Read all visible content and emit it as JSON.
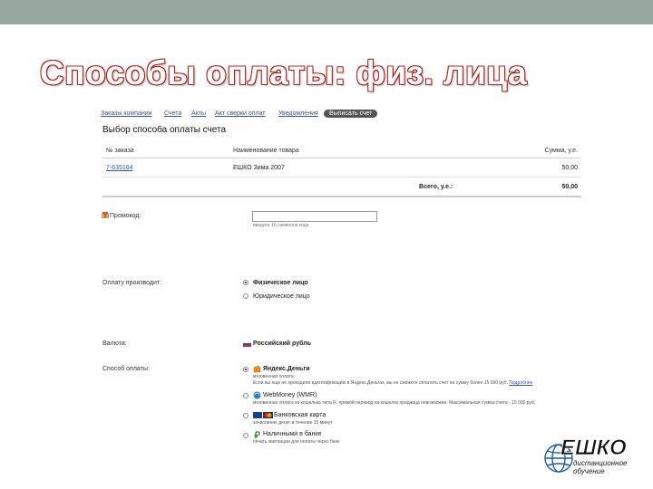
{
  "slide": {
    "title": "Способы оплаты: физ. лица"
  },
  "nav": {
    "links": [
      "Заказы компании",
      "Счета",
      "Акты",
      "Акт сверки оплат",
      "Уведомления"
    ],
    "active": "Выписать счет"
  },
  "page": {
    "heading": "Выбор способа оплаты счета"
  },
  "orders": {
    "headers": [
      "№ заказа",
      "Наименование товара",
      "Сумма, у.е."
    ],
    "rows": [
      {
        "order": "7-635164",
        "product": "ЕШКО Зима 2007",
        "amount": "50,00"
      }
    ],
    "total_label": "Всего, у.е.:",
    "total_value": "50,00"
  },
  "promo": {
    "label": "Промокод:",
    "value": "",
    "hint": "введите 16 символов кода"
  },
  "payer": {
    "label": "Оплату производит:",
    "options": [
      {
        "label": "Физическое лицо",
        "selected": true
      },
      {
        "label": "Юридическое лицо",
        "selected": false
      }
    ]
  },
  "currency": {
    "label": "Валюта:",
    "value": "Российский рубль"
  },
  "method": {
    "label": "Способ оплаты:",
    "options": [
      {
        "name": "Яндекс.Деньги",
        "icon": "yandex-money-icon",
        "selected": true,
        "desc": "мгновенная оплата",
        "desc2": "Если вы еще не проходили идентификацию в Яндекс.Деньгах, вы не сможете оплатить счет на сумму более 15 000 руб.",
        "link": "Подробнее"
      },
      {
        "name": "WebMoney (WMR)",
        "icon": "webmoney-icon",
        "selected": false,
        "desc": "мгновенная оплата из кошелька типа R, прямой перевод на кошелек продавца невозможен. Максимальная сумма счета - 15 000 руб."
      },
      {
        "name": "Банковская карта",
        "icon": "bank-card-icon",
        "selected": false,
        "desc": "зачисление денег в течение 15 минут"
      },
      {
        "name": "Наличными в банке",
        "icon": "cash-icon",
        "selected": false,
        "desc": "печать квитанции для оплаты через банк"
      }
    ]
  },
  "logo": {
    "text": "ЕШКО",
    "sub1": "дистанционное",
    "sub2": "обучение"
  },
  "colors": {
    "accent_red": "#b0231b",
    "link_blue": "#3355aa",
    "topbar": "#9aa99f",
    "logo_blue": "#1a5fa8"
  }
}
